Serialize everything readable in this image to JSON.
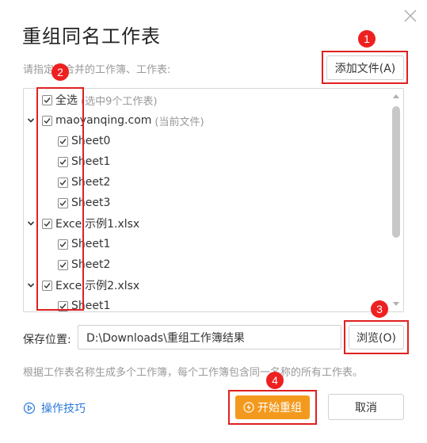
{
  "dialog": {
    "title": "重组同名工作表",
    "subtitle": "请指定要合并的工作簿、工作表:",
    "add_file_label": "添加文件(A)"
  },
  "list": {
    "select_all": {
      "label": "全选",
      "hint": "(选中9个工作表)",
      "checked": true
    },
    "workbooks": [
      {
        "name": "maoyanqing.com",
        "hint": "(当前文件)",
        "checked": true,
        "sheets": [
          "Sheet0",
          "Sheet1",
          "Sheet2",
          "Sheet3"
        ]
      },
      {
        "name": "Excel示例1.xlsx",
        "hint": "",
        "checked": true,
        "sheets": [
          "Sheet1",
          "Sheet2"
        ]
      },
      {
        "name": "Excel示例2.xlsx",
        "hint": "",
        "checked": true,
        "sheets": [
          "Sheet1"
        ]
      }
    ]
  },
  "save": {
    "label": "保存位置:",
    "path": "D:\\Downloads\\重组工作簿结果",
    "browse_label": "浏览(O)"
  },
  "note": "根据工作表名称生成多个工作簿，每个工作簿包含同一名称的所有工作表。",
  "footer": {
    "tips_label": "操作技巧",
    "start_label": "开始重组",
    "cancel_label": "取消"
  },
  "annotations": [
    "1",
    "2",
    "3",
    "4"
  ],
  "colors": {
    "accent_orange": "#f39a1e",
    "annotation_red": "#e02020",
    "link_blue": "#2b79d9"
  },
  "icons": {
    "close": "close-icon",
    "expand": "chevron-down-icon",
    "checkbox": "checkmark-icon",
    "tips": "play-circle-icon",
    "start": "merge-icon"
  }
}
